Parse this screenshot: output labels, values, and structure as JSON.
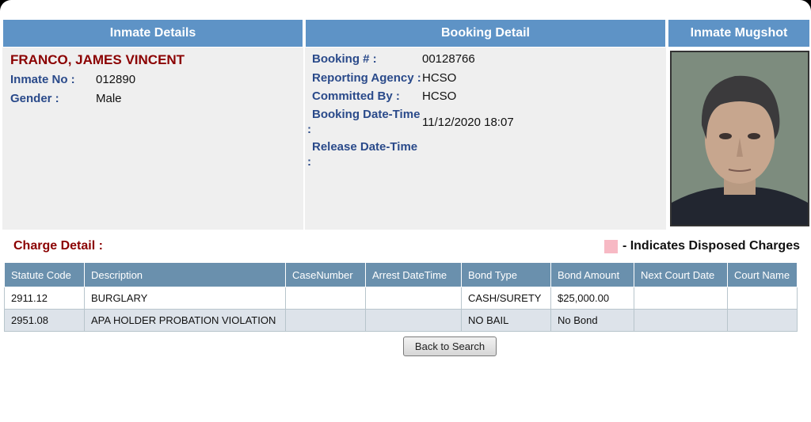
{
  "headers": {
    "inmate_details": "Inmate Details",
    "booking_detail": "Booking Detail",
    "inmate_mugshot": "Inmate Mugshot"
  },
  "inmate": {
    "name": "FRANCO, JAMES VINCENT",
    "inmate_no_label": "Inmate No :",
    "inmate_no": "012890",
    "gender_label": "Gender :",
    "gender": "Male"
  },
  "booking": {
    "booking_no_label": "Booking # :",
    "booking_no": "00128766",
    "agency_label": "Reporting Agency :",
    "agency": "HCSO",
    "committed_label": "Committed By :",
    "committed": "HCSO",
    "booking_dt_label": "Booking Date-Time",
    "booking_dt_colon": ":",
    "booking_dt": "11/12/2020 18:07",
    "release_dt_label": "Release Date-Time",
    "release_dt_colon": ":"
  },
  "charges": {
    "title": "Charge Detail :",
    "legend": "- Indicates Disposed Charges",
    "columns": [
      "Statute Code",
      "Description",
      "CaseNumber",
      "Arrest DateTime",
      "Bond Type",
      "Bond Amount",
      "Next Court Date",
      "Court Name"
    ],
    "rows": [
      [
        "2911.12",
        "BURGLARY",
        "",
        "",
        "CASH/SURETY",
        "$25,000.00",
        "",
        ""
      ],
      [
        "2951.08",
        "APA HOLDER PROBATION VIOLATION",
        "",
        "",
        "NO BAIL",
        "No Bond",
        "",
        ""
      ]
    ]
  },
  "buttons": {
    "back": "Back to Search"
  },
  "colors": {
    "header": "#5e93c6",
    "name": "#8b0000",
    "label": "#2a4a8a",
    "disposed": "#f7b9c4"
  }
}
